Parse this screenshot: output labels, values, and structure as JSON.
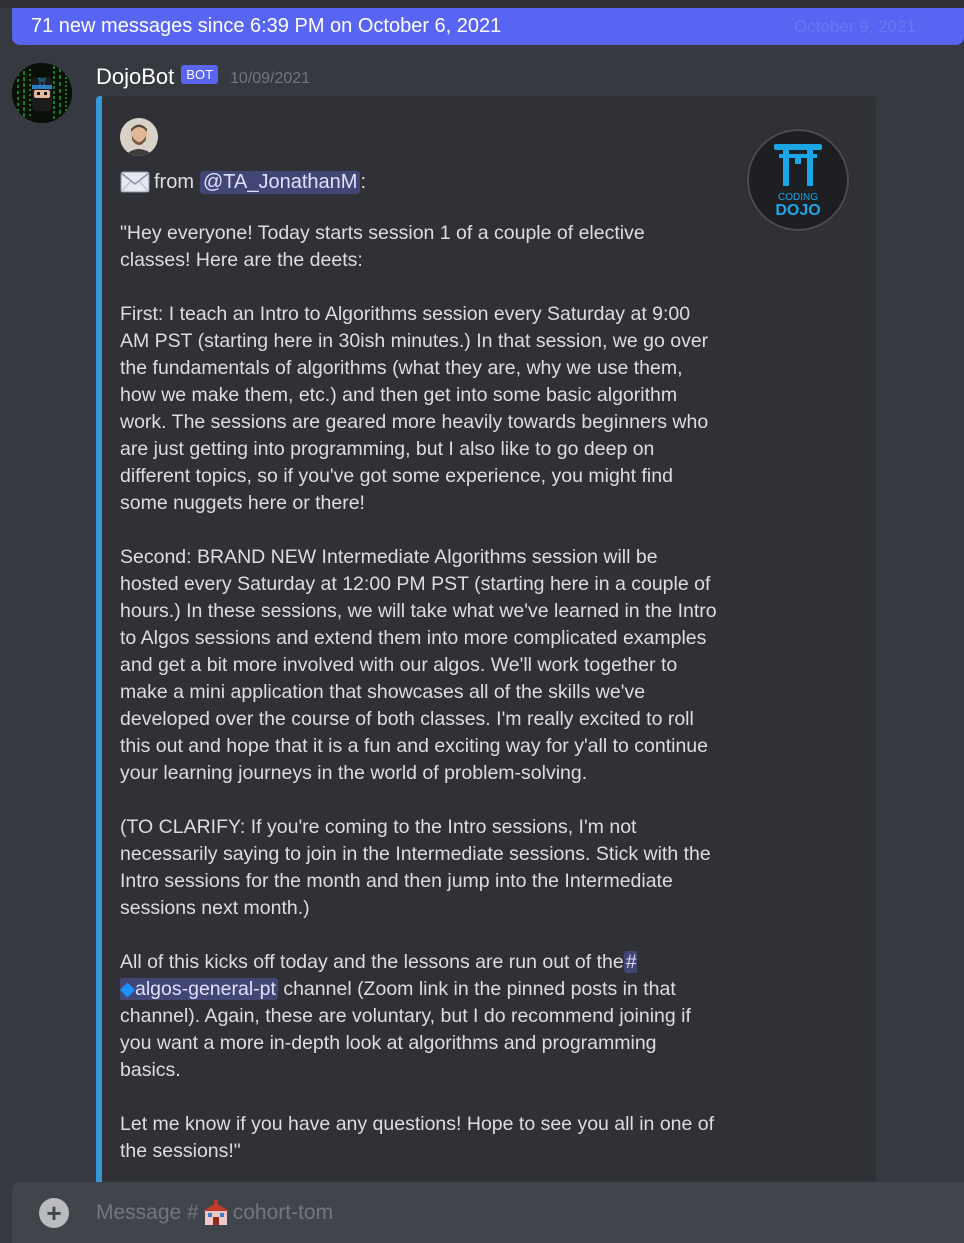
{
  "banner": {
    "text": "71 new messages since 6:39 PM on October 6, 2021",
    "ghost_date": "October 9, 2021"
  },
  "message": {
    "author": "DojoBot",
    "bot_tag": "BOT",
    "timestamp": "10/09/2021",
    "accent_color": "#3498db",
    "embed": {
      "from_prefix": "from",
      "mention": "@TA_JonathanM",
      "mention_suffix": ":",
      "thumbnail_text_top": "CODING",
      "thumbnail_text_bottom": "DOJO",
      "paragraphs": [
        "\"Hey everyone! Today starts session 1 of a couple of elective classes! Here are the deets:",
        "First: I teach an Intro to Algorithms session every Saturday at 9:00 AM PST (starting here in 30ish minutes.) In that session, we go over the fundamentals of algorithms (what they are, why we use them, how we make them, etc.) and then get into some basic algorithm work. The sessions are geared more heavily towards beginners who are just getting into programming, but I also like to go deep on different topics, so if you've got some experience, you might find some nuggets here or there!",
        "Second: BRAND NEW Intermediate Algorithms session will be hosted every Saturday at 12:00 PM PST (starting here in a couple of hours.) In these sessions, we will take what we've learned in the Intro to Algos sessions and extend them into more complicated examples and get a bit more involved with our algos. We'll work together to make a mini application that showcases all of the skills we've developed over the course of both classes. I'm really excited to roll this out and hope that it is a fun and exciting way for y'all to continue your learning journeys in the world of problem-solving.",
        "(TO CLARIFY: If you're coming to the Intro sessions, I'm not necessarily saying to join in the Intermediate sessions. Stick with the Intro sessions for the month and then jump into the Intermediate sessions next month.)"
      ],
      "channel_para_before": "All of this kicks off today and the lessons are run out of the",
      "channel_hash": "#",
      "channel_diamond": "◆",
      "channel_name": "algos-general-pt",
      "channel_para_after": " channel (Zoom link in the pinned posts in that channel). Again, these are voluntary, but I do recommend joining if you want a more in-depth look at algorithms and programming basics.",
      "closing": "Let me know if you have any questions! Hope to see you all in one of the sessions!\""
    }
  },
  "composer": {
    "add_symbol": "+",
    "placeholder_prefix": "Message #",
    "channel": "cohort-tom"
  },
  "colors": {
    "background": "#36393f",
    "embed_bg": "#2f3136",
    "blurple": "#5865f2",
    "mention_bg": "#414675"
  }
}
